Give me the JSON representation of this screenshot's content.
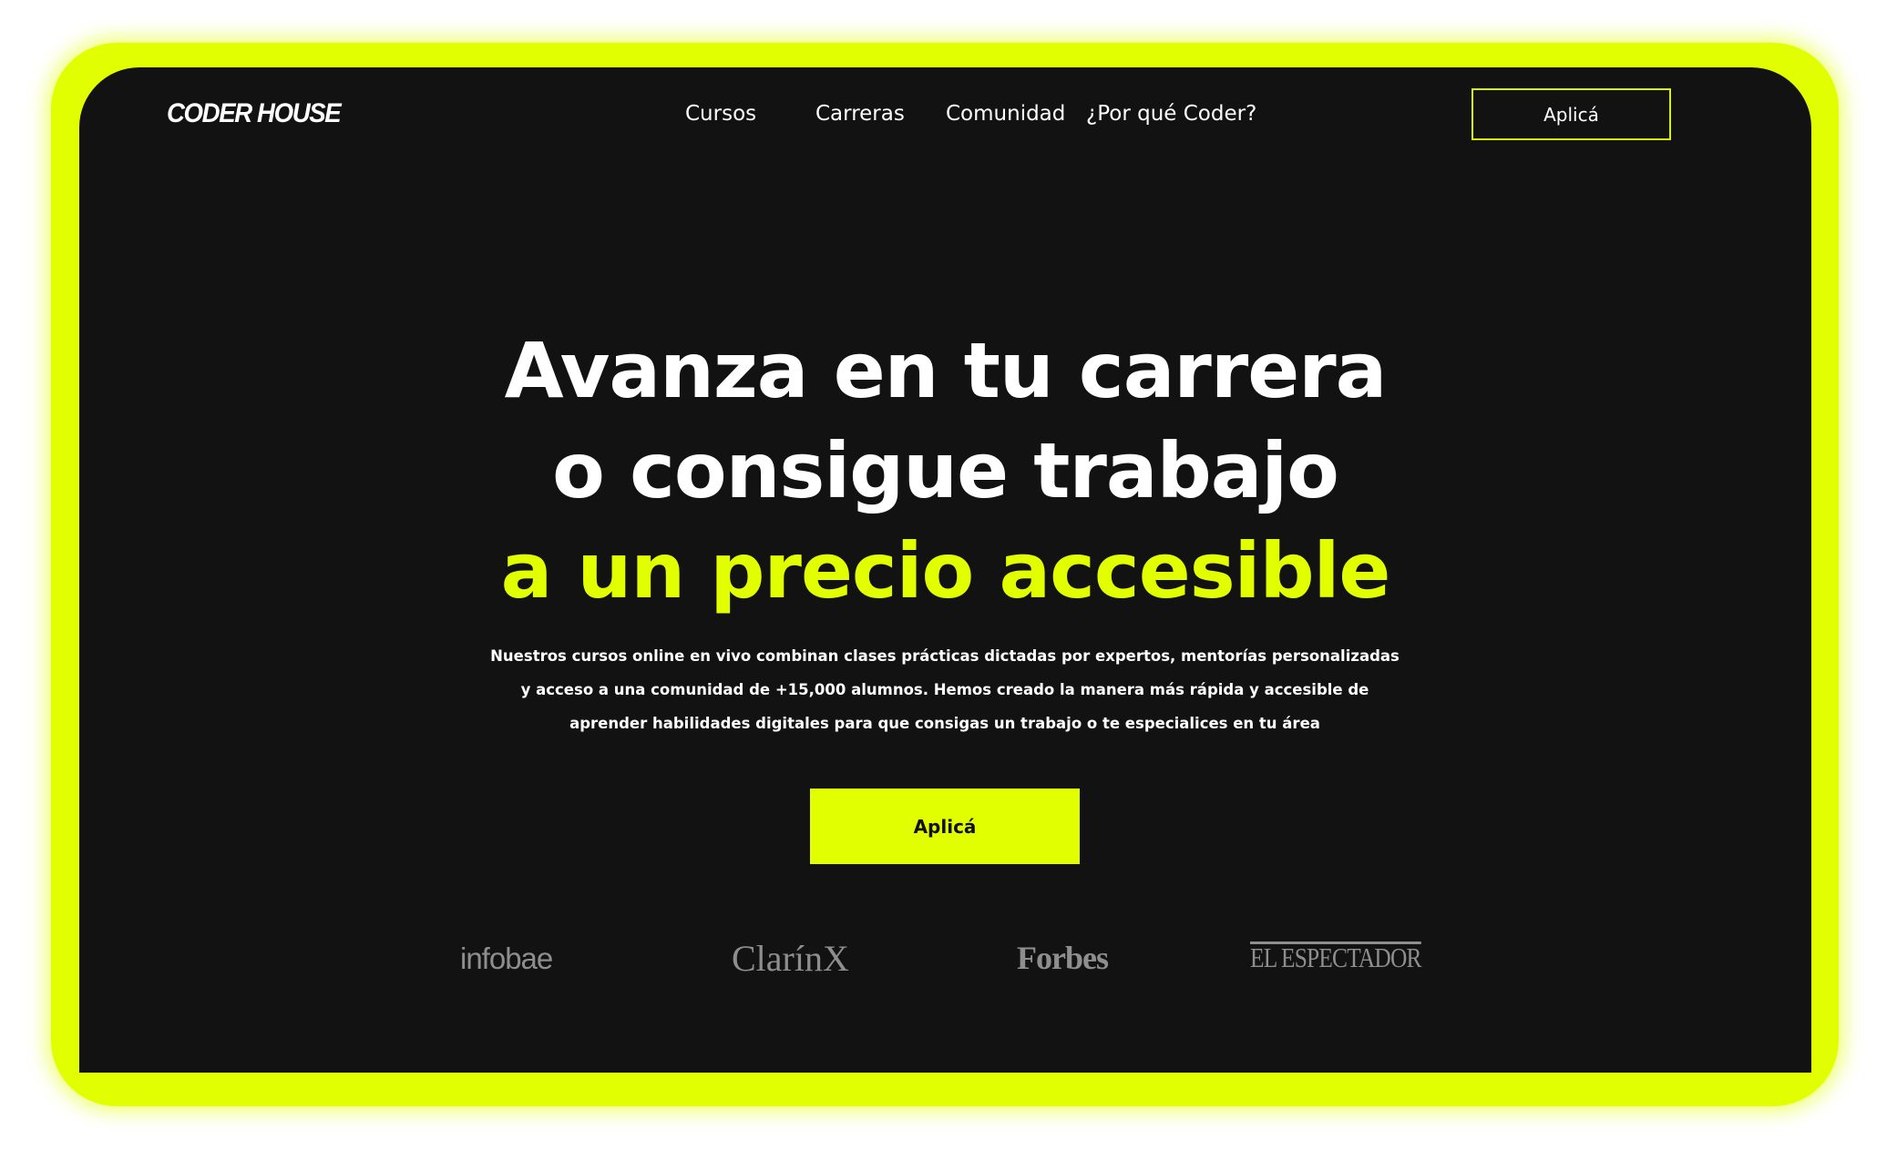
{
  "brand": {
    "logo_text": "CODER HOUSE",
    "accent_color": "#e2ff00",
    "background_color": "#121212"
  },
  "nav": {
    "items": [
      {
        "label": "Cursos"
      },
      {
        "label": "Carreras"
      },
      {
        "label": "Comunidad"
      },
      {
        "label": "¿Por qué Coder?"
      }
    ],
    "cta_label": "Aplicá"
  },
  "hero": {
    "title_line1": "Avanza en tu carrera",
    "title_line2": "o consigue trabajo",
    "title_line3": "a un precio accesible",
    "description": "Nuestros cursos online en vivo combinan clases prácticas dictadas por expertos, mentorías personalizadas y acceso a una comunidad de +15,000 alumnos. Hemos creado la manera más rápida y accesible de aprender habilidades digitales para que consigas un trabajo o te especialices en tu área",
    "cta_label": "Aplicá"
  },
  "press": {
    "logos": [
      {
        "name": "infobae"
      },
      {
        "name": "ClarínX"
      },
      {
        "name": "Forbes"
      },
      {
        "name": "EL ESPECTADOR"
      }
    ]
  }
}
